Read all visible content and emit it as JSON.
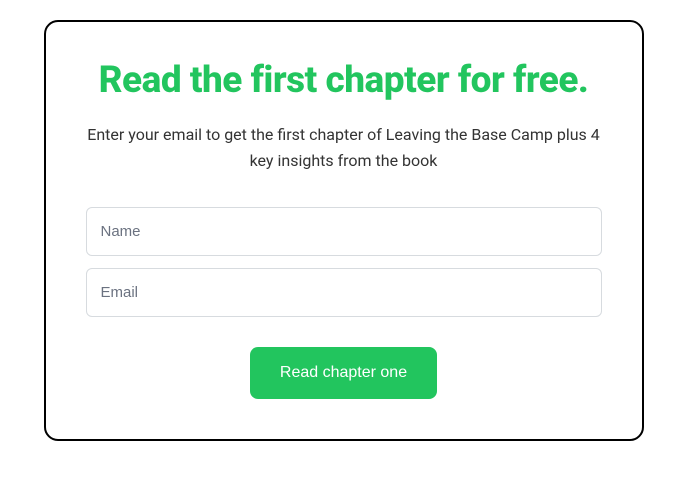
{
  "form": {
    "title": "Read the first chapter for free.",
    "subtitle": "Enter your email to get the first chapter of Leaving the Base Camp plus 4 key insights from the book",
    "name_placeholder": "Name",
    "email_placeholder": "Email",
    "submit_label": "Read chapter one"
  }
}
